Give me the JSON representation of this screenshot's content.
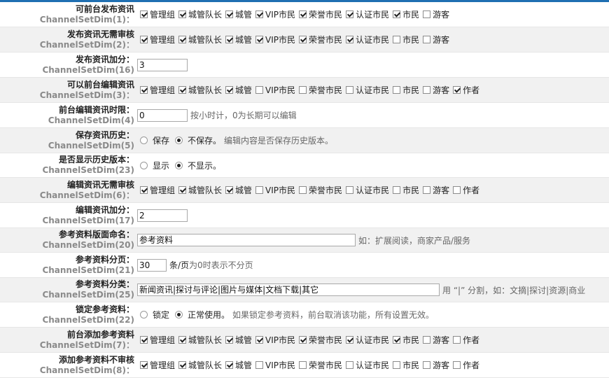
{
  "roles": [
    "管理组",
    "城管队长",
    "城管",
    "VIP市民",
    "荣誉市民",
    "认证市民",
    "市民",
    "游客"
  ],
  "rows": [
    {
      "title": "可前台发布资讯",
      "key": "ChannelSetDim(1)：",
      "checked": [
        true,
        true,
        true,
        true,
        true,
        true,
        true,
        false
      ]
    },
    {
      "title": "发布资讯无需审核",
      "key": "ChannelSetDim(2)：",
      "checked": [
        true,
        true,
        true,
        true,
        true,
        true,
        false,
        false
      ]
    },
    {
      "title": "发布资讯加分：",
      "key": "ChannelSetDim(16)",
      "value": "3"
    },
    {
      "title": "可以前台编辑资讯",
      "key": "ChannelSetDim(3)：",
      "checked": [
        true,
        true,
        true,
        false,
        false,
        false,
        false,
        false
      ],
      "author_label": "作者",
      "author_checked": true
    },
    {
      "title": "前台编辑资讯时限：",
      "key": "ChannelSetDim(4)",
      "value": "0",
      "hint": "按小时计，0为长期可以编辑"
    },
    {
      "title": "保存资讯历史：",
      "key": "ChannelSetDim(5)",
      "options": [
        "保存",
        "不保存。"
      ],
      "selected": 1,
      "hint": "编辑内容是否保存历史版本。"
    },
    {
      "title": "是否显示历史版本：",
      "key": "ChannelSetDim(23)",
      "options": [
        "显示",
        "不显示。"
      ],
      "selected": 1
    },
    {
      "title": "编辑资讯无需审核",
      "key": "ChannelSetDim(6)：",
      "checked": [
        true,
        true,
        true,
        false,
        false,
        false,
        false,
        false
      ],
      "author_label": "作者",
      "author_checked": false
    },
    {
      "title": "编辑资讯加分：",
      "key": "ChannelSetDim(17)",
      "value": "2"
    },
    {
      "title": "参考资料版面命名：",
      "key": "ChannelSetDim(20)",
      "value": "参考资料",
      "hint": "如：扩展阅读，商家产品/服务"
    },
    {
      "title": "参考资料分页：",
      "key": "ChannelSetDim(21)",
      "value": "30",
      "unit": "条/页",
      "hint": "为0时表示不分页"
    },
    {
      "title": "参考资料分类：",
      "key": "ChannelSetDim(25)",
      "value": "新闻资讯|探讨与评论|图片与媒体|文档下载|其它",
      "hint": "用 “|” 分割，如：文摘|探讨|资源|商业"
    },
    {
      "title": "锁定参考资料：",
      "key": "ChannelSetDim(22)",
      "options": [
        "锁定",
        "正常使用。"
      ],
      "selected": 1,
      "hint": "如果锁定参考资料，前台取消该功能，所有设置无效。"
    },
    {
      "title": "前台添加参考资料",
      "key": "ChannelSetDim(7)：",
      "checked": [
        true,
        true,
        true,
        true,
        true,
        true,
        true,
        false
      ],
      "author_label": "作者",
      "author_checked": false
    },
    {
      "title": "添加参考资料不审核",
      "key": "ChannelSetDim(8)：",
      "checked": [
        true,
        true,
        true,
        false,
        false,
        false,
        false,
        false
      ],
      "author_label": "作者",
      "author_checked": false
    }
  ]
}
